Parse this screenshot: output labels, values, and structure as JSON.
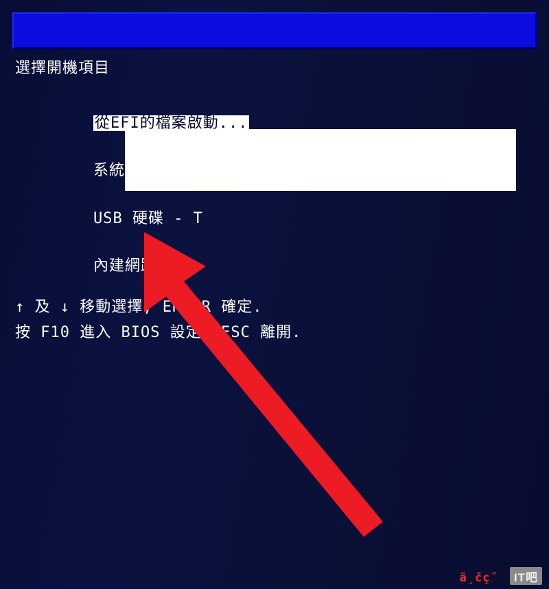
{
  "boot_menu": {
    "title": "選擇開機項目",
    "items": [
      {
        "label": "從EFI的檔案啟動...",
        "selected": true
      },
      {
        "label": "系統內建硬碟",
        "selected": false
      },
      {
        "label": "USB 硬碟 - T",
        "selected": false
      },
      {
        "label": "內建網路裝置",
        "selected": false
      }
    ],
    "hint_nav": "↑ 及 ↓ 移動選擇,  ENTER 確定.",
    "hint_keys": "按 F10 進入 BIOS 設定,  ESC 離開."
  },
  "watermark": {
    "prefix": "ä¸čç˝",
    "badge": "IT吧"
  },
  "annotation": {
    "arrow_color": "#ed1c24"
  }
}
